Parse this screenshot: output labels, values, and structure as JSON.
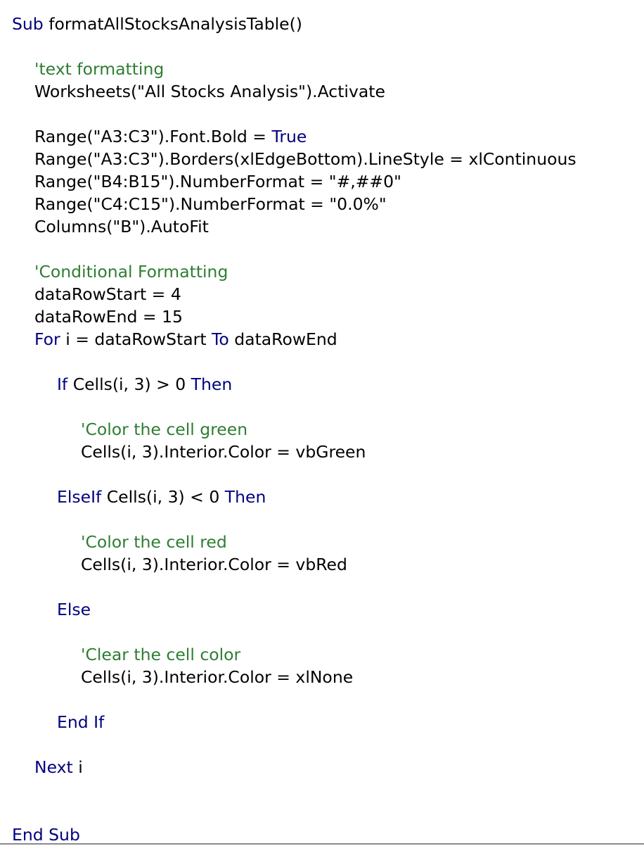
{
  "editor": {
    "colors": {
      "keyword": "#000080",
      "comment": "#2e7d32",
      "code": "#000000",
      "background": "#ffffff"
    },
    "lines": [
      {
        "indent": 0,
        "tokens": [
          {
            "t": "Sub",
            "k": "keyword"
          },
          {
            "t": " formatAllStocksAnalysisTable()",
            "k": "code"
          }
        ]
      },
      {
        "indent": 1,
        "tokens": [
          {
            "t": "'text formatting",
            "k": "comment"
          }
        ]
      },
      {
        "indent": 1,
        "tokens": [
          {
            "t": "Worksheets(\"All Stocks Analysis\").Activate",
            "k": "code"
          }
        ]
      },
      {
        "indent": 1,
        "tokens": [
          {
            "t": "Range(\"A3:C3\").Font.Bold = ",
            "k": "code"
          },
          {
            "t": "True",
            "k": "keyword"
          }
        ]
      },
      {
        "indent": 1,
        "tokens": [
          {
            "t": "Range(\"A3:C3\").Borders(xlEdgeBottom).LineStyle = xlContinuous",
            "k": "code"
          }
        ]
      },
      {
        "indent": 1,
        "tokens": [
          {
            "t": "Range(\"B4:B15\").NumberFormat = \"#,##0\"",
            "k": "code"
          }
        ]
      },
      {
        "indent": 1,
        "tokens": [
          {
            "t": "Range(\"C4:C15\").NumberFormat = \"0.0%\"",
            "k": "code"
          }
        ]
      },
      {
        "indent": 1,
        "tokens": [
          {
            "t": "Columns(\"B\").AutoFit",
            "k": "code"
          }
        ]
      },
      {
        "indent": 1,
        "tokens": [
          {
            "t": "'Conditional Formatting",
            "k": "comment"
          }
        ]
      },
      {
        "indent": 1,
        "tokens": [
          {
            "t": "dataRowStart = 4",
            "k": "code"
          }
        ]
      },
      {
        "indent": 1,
        "tokens": [
          {
            "t": "dataRowEnd = 15",
            "k": "code"
          }
        ]
      },
      {
        "indent": 1,
        "tokens": [
          {
            "t": "For",
            "k": "keyword"
          },
          {
            "t": " i = dataRowStart ",
            "k": "code"
          },
          {
            "t": "To",
            "k": "keyword"
          },
          {
            "t": " dataRowEnd",
            "k": "code"
          }
        ]
      },
      {
        "indent": 2,
        "tokens": [
          {
            "t": "If",
            "k": "keyword"
          },
          {
            "t": " Cells(i, 3) > 0 ",
            "k": "code"
          },
          {
            "t": "Then",
            "k": "keyword"
          }
        ]
      },
      {
        "indent": 3,
        "tokens": [
          {
            "t": "'Color the cell green",
            "k": "comment"
          }
        ]
      },
      {
        "indent": 3,
        "tokens": [
          {
            "t": "Cells(i, 3).Interior.Color = vbGreen",
            "k": "code"
          }
        ]
      },
      {
        "indent": 2,
        "tokens": [
          {
            "t": "ElseIf",
            "k": "keyword"
          },
          {
            "t": " Cells(i, 3) < 0 ",
            "k": "code"
          },
          {
            "t": "Then",
            "k": "keyword"
          }
        ]
      },
      {
        "indent": 3,
        "tokens": [
          {
            "t": "'Color the cell red",
            "k": "comment"
          }
        ]
      },
      {
        "indent": 3,
        "tokens": [
          {
            "t": "Cells(i, 3).Interior.Color = vbRed",
            "k": "code"
          }
        ]
      },
      {
        "indent": 2,
        "tokens": [
          {
            "t": "Else",
            "k": "keyword"
          }
        ]
      },
      {
        "indent": 3,
        "tokens": [
          {
            "t": "'Clear the cell color",
            "k": "comment"
          }
        ]
      },
      {
        "indent": 3,
        "tokens": [
          {
            "t": "Cells(i, 3).Interior.Color = xlNone",
            "k": "code"
          }
        ]
      },
      {
        "indent": 2,
        "tokens": [
          {
            "t": "End If",
            "k": "keyword"
          }
        ]
      },
      {
        "indent": 1,
        "tokens": [
          {
            "t": "Next",
            "k": "keyword"
          },
          {
            "t": " i",
            "k": "code"
          }
        ]
      },
      {
        "indent": 0,
        "tokens": [
          {
            "t": "End Sub",
            "k": "keyword"
          }
        ]
      }
    ]
  }
}
